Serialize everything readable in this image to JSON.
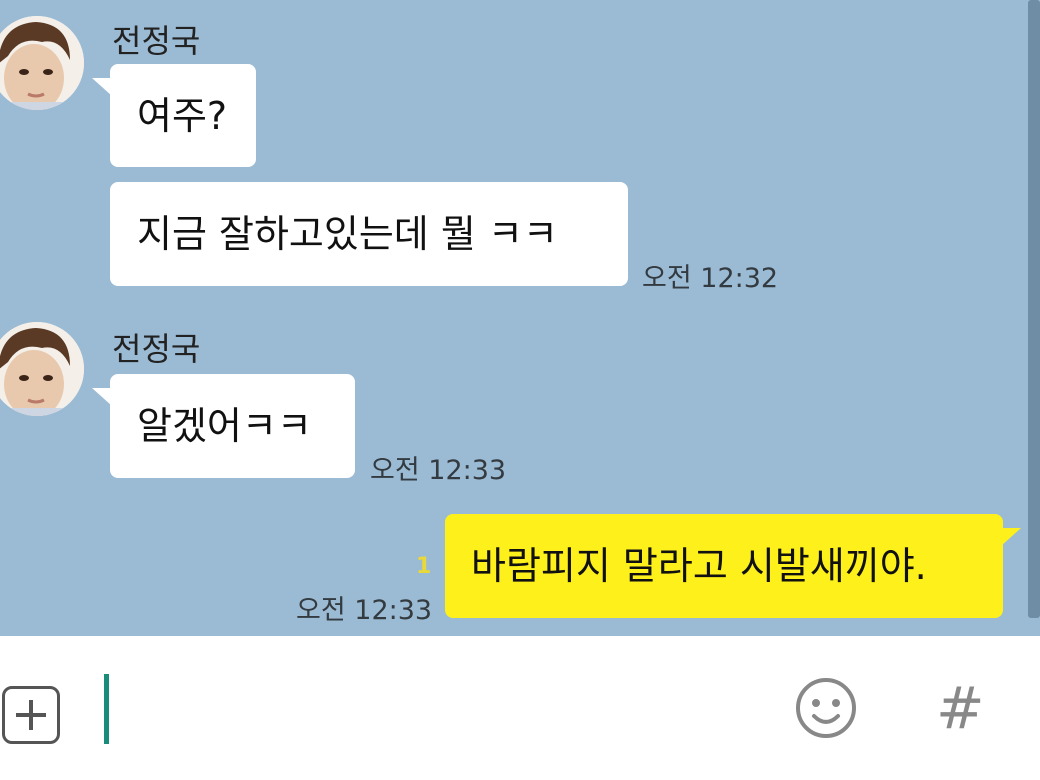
{
  "chat": {
    "messages": [
      {
        "sender": "전정국",
        "bubbles": [
          "여주?",
          "지금 잘하고있는데 뭘 ㅋㅋ"
        ],
        "time": "오전 12:32"
      },
      {
        "sender": "전정국",
        "bubbles": [
          "알겠어ㅋㅋ"
        ],
        "time": "오전 12:33"
      },
      {
        "outgoing": true,
        "text": "바람피지 말라고 시발새끼야.",
        "unread": "1",
        "time": "오전 12:33"
      }
    ]
  },
  "input": {
    "icons": [
      "add-icon",
      "emoji-icon",
      "hashtag-icon"
    ],
    "hash_glyph": "#"
  },
  "colors": {
    "chat_background": "#9bbbd4",
    "outgoing_bubble": "#fef01b",
    "incoming_bubble": "#ffffff",
    "caret": "#1a8c7c"
  }
}
